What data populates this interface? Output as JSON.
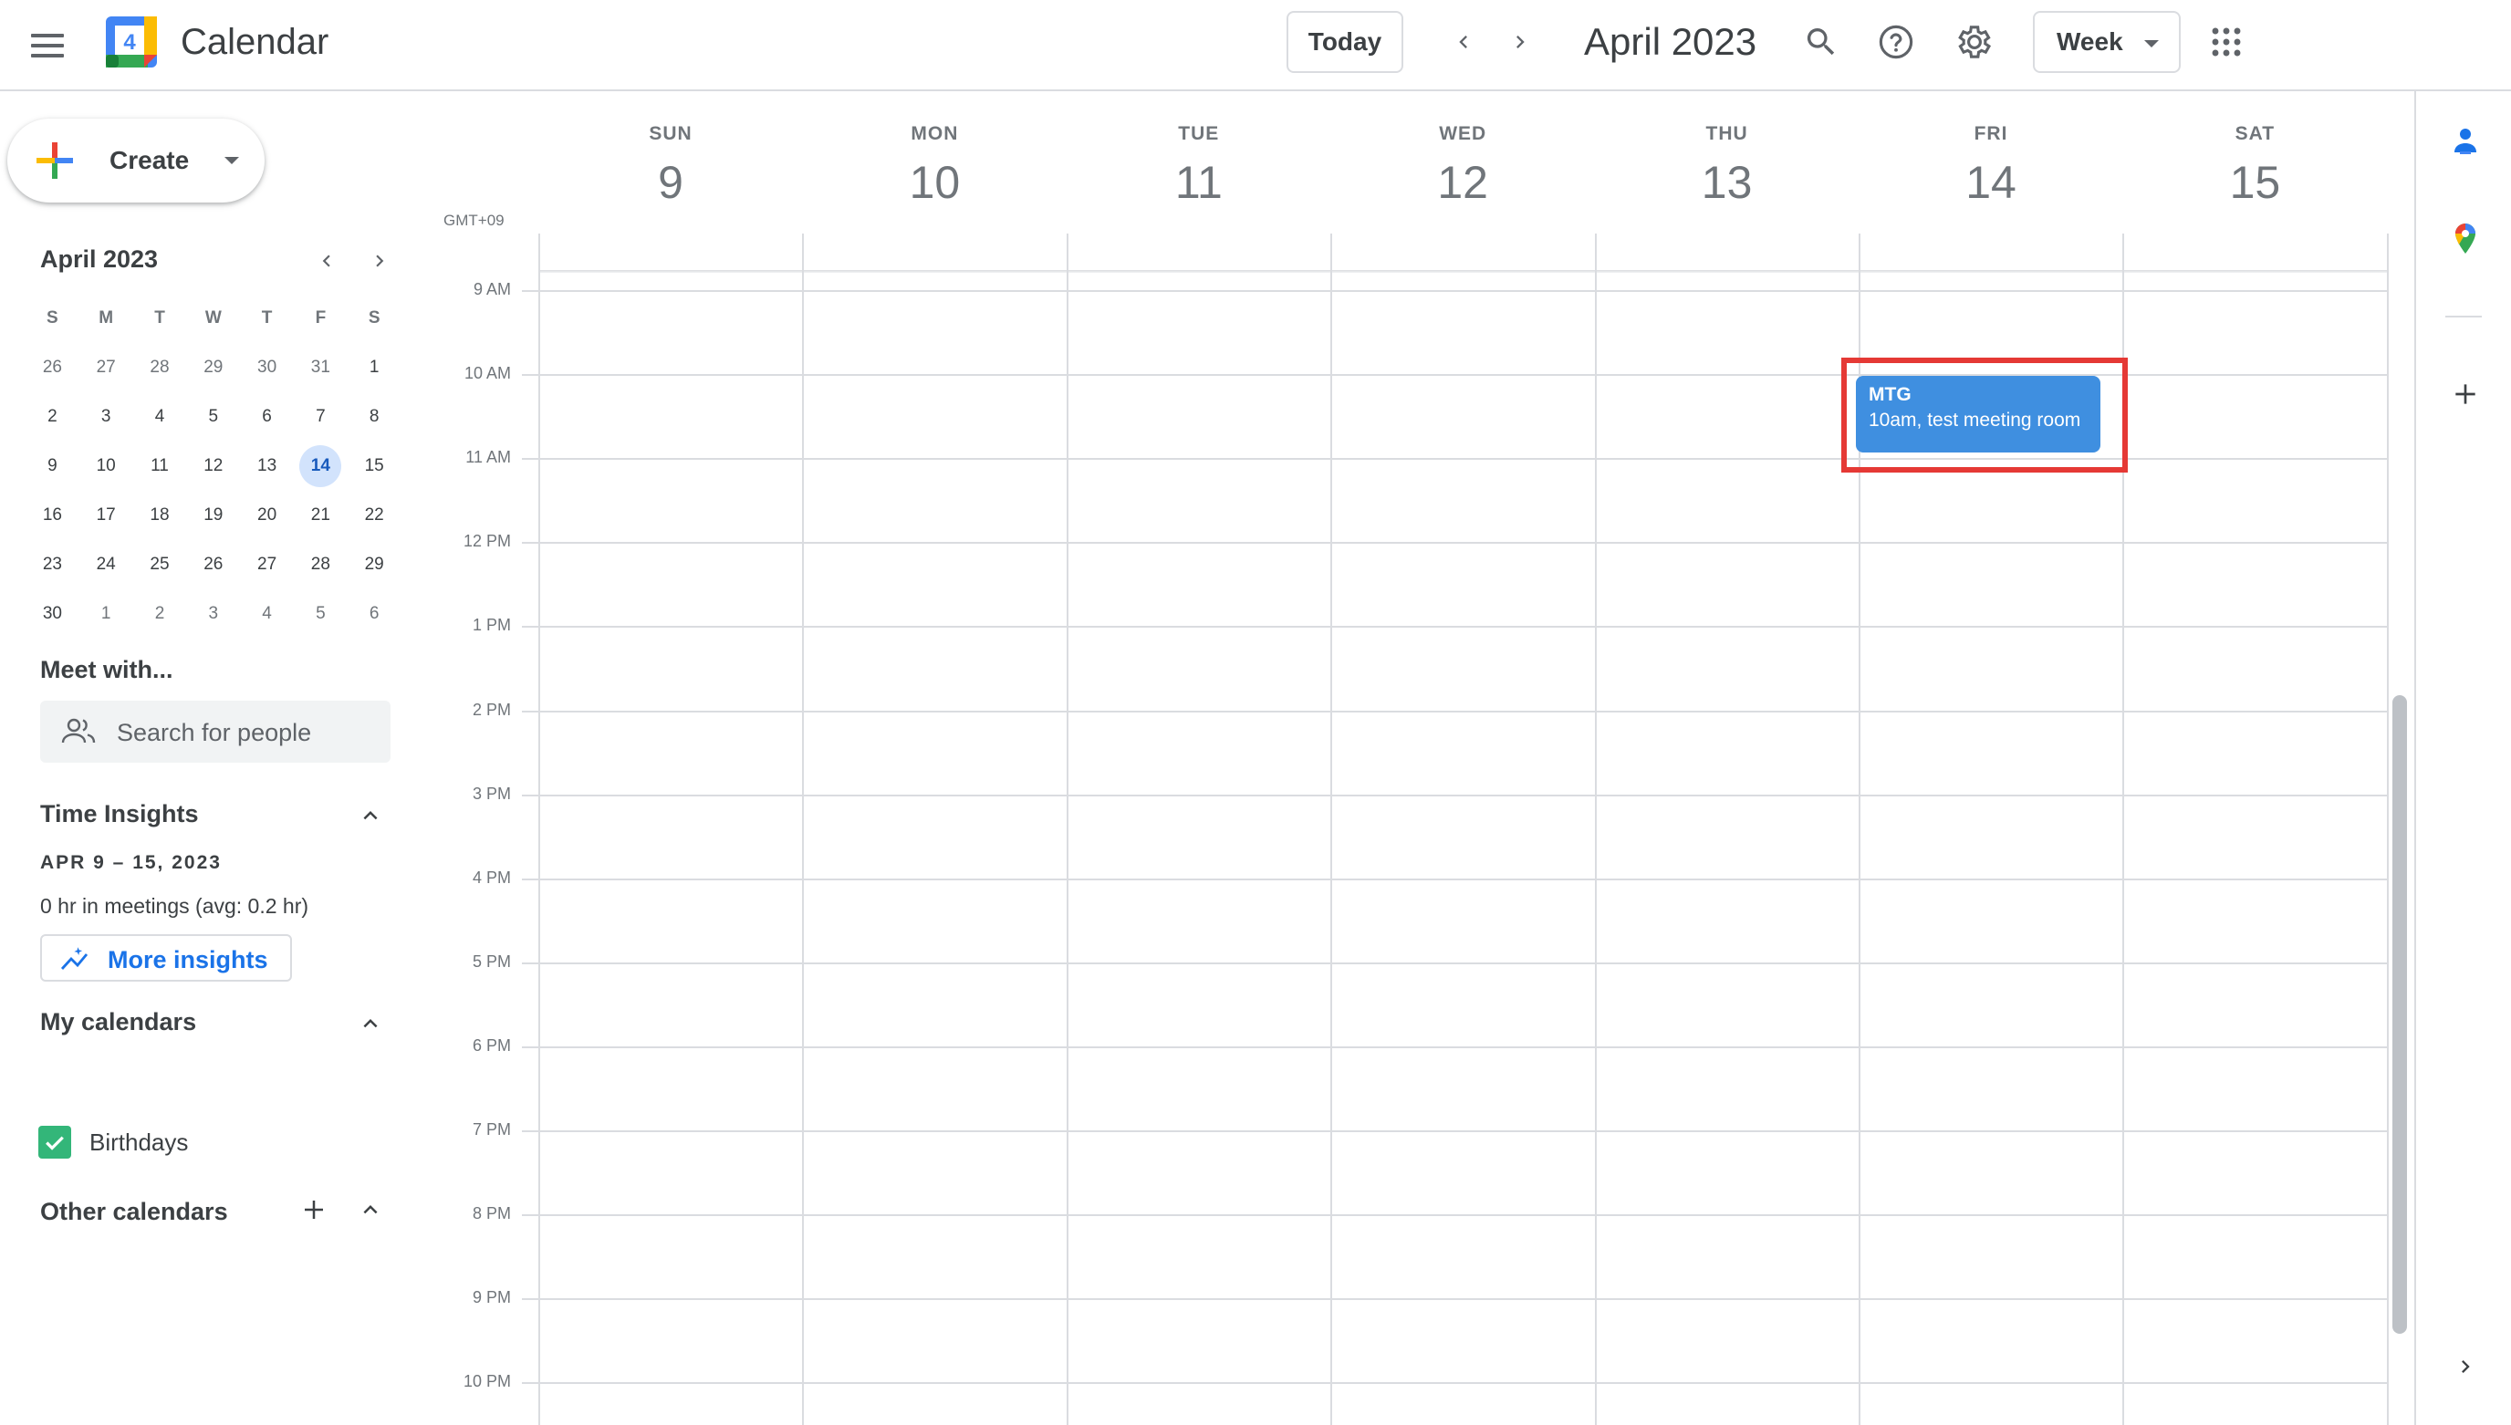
{
  "header": {
    "app_title": "Calendar",
    "logo_day": "4",
    "today_label": "Today",
    "period_title": "April 2023",
    "view_label": "Week"
  },
  "sidebar": {
    "create_label": "Create",
    "mini_calendar": {
      "title": "April 2023",
      "weekday_headers": [
        "S",
        "M",
        "T",
        "W",
        "T",
        "F",
        "S"
      ],
      "weeks": [
        [
          "26",
          "27",
          "28",
          "29",
          "30",
          "31",
          "1"
        ],
        [
          "2",
          "3",
          "4",
          "5",
          "6",
          "7",
          "8"
        ],
        [
          "9",
          "10",
          "11",
          "12",
          "13",
          "14",
          "15"
        ],
        [
          "16",
          "17",
          "18",
          "19",
          "20",
          "21",
          "22"
        ],
        [
          "23",
          "24",
          "25",
          "26",
          "27",
          "28",
          "29"
        ],
        [
          "30",
          "1",
          "2",
          "3",
          "4",
          "5",
          "6"
        ]
      ],
      "selected_day": "14"
    },
    "meet_with": {
      "title": "Meet with...",
      "search_placeholder": "Search for people"
    },
    "time_insights": {
      "title": "Time Insights",
      "range": "APR 9 – 15, 2023",
      "summary": "0 hr in meetings (avg: 0.2 hr)",
      "more_label": "More insights"
    },
    "my_calendars": {
      "title": "My calendars",
      "items": [
        {
          "label": "Birthdays",
          "checked": true,
          "color": "#33b679"
        }
      ]
    },
    "other_calendars": {
      "title": "Other calendars"
    }
  },
  "week_view": {
    "timezone": "GMT+09",
    "days": [
      {
        "name": "SUN",
        "num": "9"
      },
      {
        "name": "MON",
        "num": "10"
      },
      {
        "name": "TUE",
        "num": "11"
      },
      {
        "name": "WED",
        "num": "12"
      },
      {
        "name": "THU",
        "num": "13"
      },
      {
        "name": "FRI",
        "num": "14"
      },
      {
        "name": "SAT",
        "num": "15"
      }
    ],
    "hours": [
      "9 AM",
      "10 AM",
      "11 AM",
      "12 PM",
      "1 PM",
      "2 PM",
      "3 PM",
      "4 PM",
      "5 PM",
      "6 PM",
      "7 PM",
      "8 PM",
      "9 PM",
      "10 PM"
    ],
    "events": [
      {
        "title": "MTG",
        "detail": "10am, test meeting room",
        "day": "FRI",
        "start": "10am",
        "color": "#3f8fe0",
        "highlighted": true
      }
    ]
  },
  "colors": {
    "accent": "#1a73e8",
    "event": "#3f8fe0",
    "highlight": "#e53935",
    "selected_day_bg": "#d2e3fc"
  }
}
